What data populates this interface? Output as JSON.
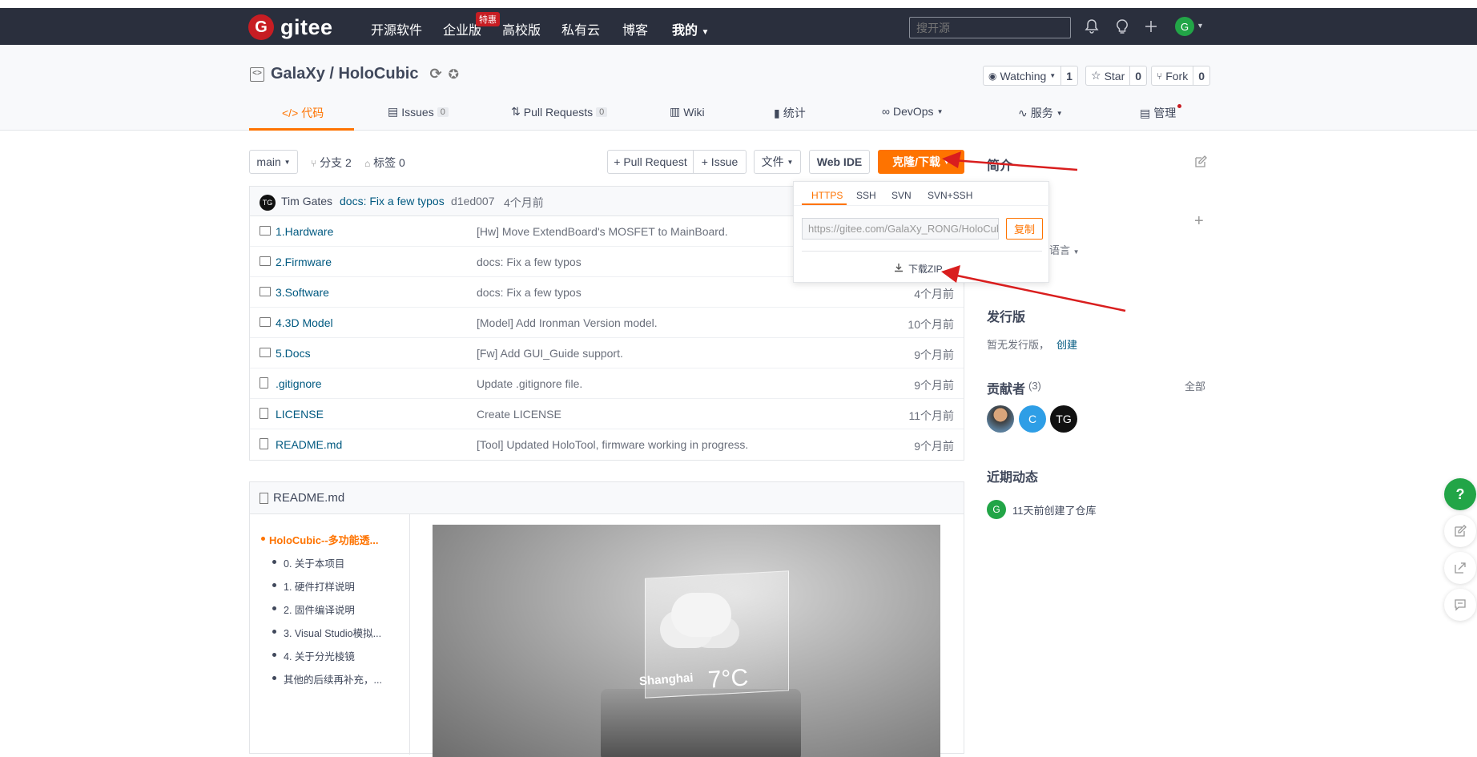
{
  "brand": {
    "logo_letter": "G",
    "name": "gitee"
  },
  "nav": {
    "items": [
      "开源软件",
      "企业版",
      "高校版",
      "私有云",
      "博客",
      "我的"
    ],
    "badge": "特惠",
    "search_placeholder": "搜开源",
    "avatar_letter": "G"
  },
  "repo": {
    "title": "GalaXy / HoloCubic",
    "watching_label": "Watching",
    "watching_count": "1",
    "star_label": "Star",
    "star_count": "0",
    "fork_label": "Fork",
    "fork_count": "0"
  },
  "tabs": [
    {
      "label": "代码"
    },
    {
      "label": "Issues",
      "count": "0"
    },
    {
      "label": "Pull Requests",
      "count": "0"
    },
    {
      "label": "Wiki"
    },
    {
      "label": "统计"
    },
    {
      "label": "DevOps"
    },
    {
      "label": "服务"
    },
    {
      "label": "管理"
    }
  ],
  "toolbar": {
    "branch": "main",
    "branches": "分支 2",
    "tags": "标签 0",
    "pull_request": "+ Pull Request",
    "issue": "+ Issue",
    "files": "文件",
    "web_ide": "Web IDE",
    "clone": "克隆/下载"
  },
  "commit": {
    "avatar": "TG",
    "author": "Tim Gates",
    "message": "docs: Fix a few typos",
    "hash": "d1ed007",
    "time": "4个月前"
  },
  "files": [
    {
      "name": "1.Hardware",
      "type": "dir",
      "message": "[Hw] Move ExtendBoard's MOSFET to MainBoard.",
      "time": ""
    },
    {
      "name": "2.Firmware",
      "type": "dir",
      "message": "docs: Fix a few typos",
      "time": ""
    },
    {
      "name": "3.Software",
      "type": "dir",
      "message": "docs: Fix a few typos",
      "time": "4个月前"
    },
    {
      "name": "4.3D Model",
      "type": "dir",
      "message": "[Model] Add Ironman Version model.",
      "time": "10个月前"
    },
    {
      "name": "5.Docs",
      "type": "dir",
      "message": "[Fw] Add GUI_Guide support.",
      "time": "9个月前"
    },
    {
      "name": ".gitignore",
      "type": "file",
      "message": "Update .gitignore file.",
      "time": "9个月前"
    },
    {
      "name": "LICENSE",
      "type": "file",
      "message": "Create LICENSE",
      "time": "11个月前"
    },
    {
      "name": "README.md",
      "type": "file",
      "message": "[Tool] Updated HoloTool, firmware working in progress.",
      "time": "9个月前"
    }
  ],
  "clone_dropdown": {
    "tabs": [
      "HTTPS",
      "SSH",
      "SVN",
      "SVN+SSH"
    ],
    "url": "https://gitee.com/GalaXy_RONG/HoloCubic.git",
    "copy": "复制",
    "download_zip": "下载ZIP"
  },
  "readme": {
    "title": "README.md",
    "toc_heading": "HoloCubic--多功能透...",
    "toc": [
      "0. 关于本项目",
      "1. 硬件打样说明",
      "2. 固件编译说明",
      "3. Visual Studio模拟...",
      "4. 关于分光棱镜",
      "其他的后续再补充，..."
    ],
    "image_city": "Shanghai",
    "image_temp": "7°C"
  },
  "sidebar": {
    "intro_title": "简介",
    "lang_label": "语言",
    "release_title": "发行版",
    "release_text": "暂无发行版，",
    "release_link": "创建",
    "contrib_title": "贡献者",
    "contrib_count": "(3)",
    "contrib_all": "全部",
    "contributors": [
      "",
      "C",
      "TG"
    ],
    "activity_title": "近期动态",
    "activity_avatar": "G",
    "activity_text": "11天前创建了仓库"
  },
  "colors": {
    "accent": "#fe7300",
    "nav_bg": "#2a2f3d",
    "brand_red": "#c71d23",
    "link": "#005980",
    "arrow": "#d91e1e"
  },
  "icons": [
    "bell-icon",
    "bulb-icon",
    "plus-icon",
    "help-icon",
    "edit-icon",
    "share-icon",
    "comment-icon",
    "download-icon"
  ]
}
